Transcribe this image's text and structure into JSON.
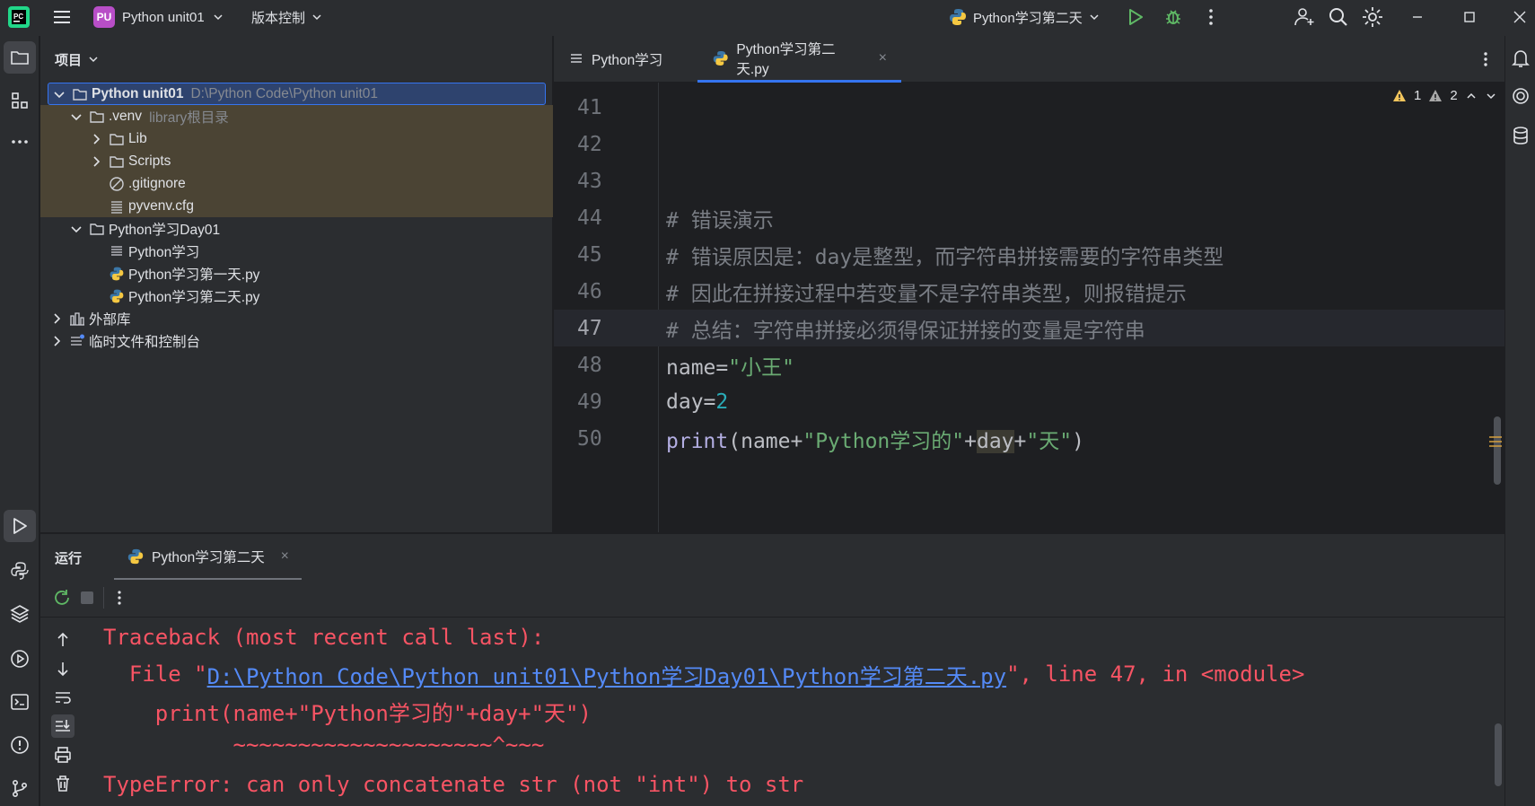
{
  "titlebar": {
    "project_badge": "PU",
    "project_name": "Python unit01",
    "vcs_label": "版本控制",
    "run_config": "Python学习第二天"
  },
  "project_panel": {
    "title": "项目",
    "tree": [
      {
        "label": "Python unit01",
        "hint": "D:\\Python Code\\Python unit01"
      },
      {
        "label": ".venv",
        "hint": "library根目录"
      },
      {
        "label": "Lib"
      },
      {
        "label": "Scripts"
      },
      {
        "label": ".gitignore"
      },
      {
        "label": "pyvenv.cfg"
      },
      {
        "label": "Python学习Day01"
      },
      {
        "label": "Python学习"
      },
      {
        "label": "Python学习第一天.py"
      },
      {
        "label": "Python学习第二天.py"
      },
      {
        "label": "外部库"
      },
      {
        "label": "临时文件和控制台"
      }
    ]
  },
  "editor": {
    "tabs": [
      {
        "label": "Python学习"
      },
      {
        "label": "Python学习第二天.py",
        "close": "×"
      }
    ],
    "warnings": {
      "warn_count": "1",
      "weak_warn_count": "2"
    },
    "lines": [
      {
        "num": "41"
      },
      {
        "num": "42"
      },
      {
        "num": "43"
      },
      {
        "num": "44",
        "text": "# 错误演示"
      },
      {
        "num": "45",
        "text": "# 错误原因是：day是整型，而字符串拼接需要的字符串类型"
      },
      {
        "num": "46",
        "text": "# 因此在拼接过程中若变量不是字符串类型，则报错提示"
      },
      {
        "num": "47",
        "text": "# 总结：字符串拼接必须得保证拼接的变量是字符串"
      },
      {
        "num": "48",
        "t1": "name",
        "t2": "=",
        "t3": "\"小王\""
      },
      {
        "num": "49",
        "t1": "day",
        "t2": "=",
        "t3": "2"
      },
      {
        "num": "50",
        "t1": "print",
        "t2": "(name+",
        "t3": "\"Python学习的\"",
        "t4": "+",
        "t5": "day",
        "t6": "+",
        "t7": "\"天\"",
        "t8": ")"
      }
    ]
  },
  "run_panel": {
    "title": "运行",
    "tab_label": "Python学习第二天",
    "tab_close": "×",
    "console": {
      "line1": "Traceback (most recent call last):",
      "line2_pre": "  File \"",
      "line2_link": "D:\\Python Code\\Python unit01\\Python学习Day01\\Python学习第二天.py",
      "line2_post": "\", line 47, in <module>",
      "line3": "    print(name+\"Python学习的\"+day+\"天\")",
      "line4": "          ~~~~~~~~~~~~~~~~~~~~^~~~",
      "line5": "TypeError: can only concatenate str (not \"int\") to str"
    }
  },
  "colors": {
    "accent": "#3574f0",
    "error_text": "#f75464",
    "string": "#6aab73",
    "number": "#2aacb8",
    "comment": "#7a7e85",
    "run_green": "#5fb865"
  }
}
